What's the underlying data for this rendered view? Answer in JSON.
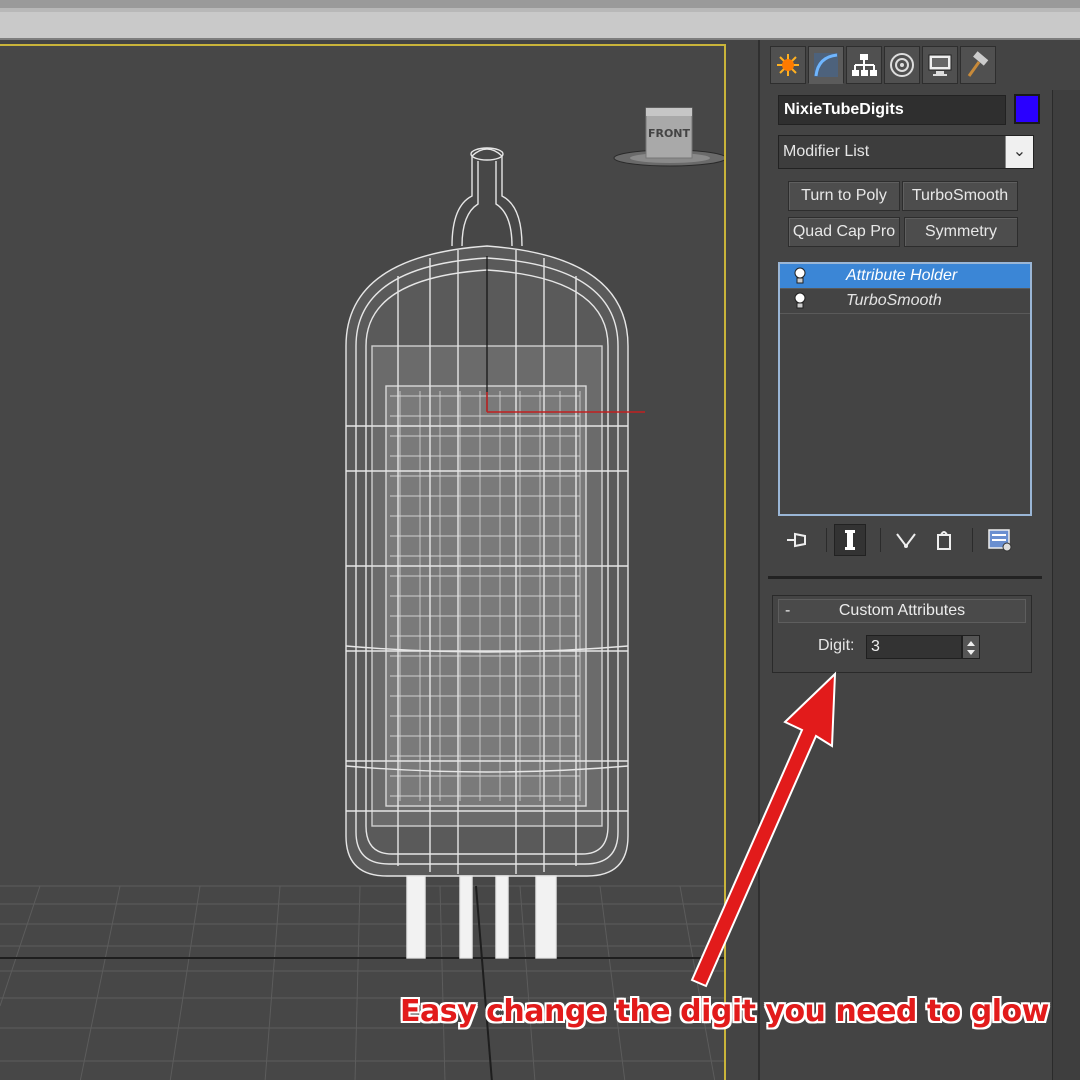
{
  "command_panel": {
    "tabs": [
      {
        "name": "create",
        "icon": "sun-burst-icon"
      },
      {
        "name": "modify",
        "icon": "curve-icon"
      },
      {
        "name": "hierarchy",
        "icon": "hierarchy-icon"
      },
      {
        "name": "motion",
        "icon": "motion-icon"
      },
      {
        "name": "display",
        "icon": "display-icon"
      },
      {
        "name": "utilities",
        "icon": "hammer-icon"
      }
    ],
    "object_name": "NixieTubeDigits",
    "object_color": "#2a00ff",
    "modifier_list": "Modifier List",
    "modifier_buttons": [
      "Turn to Poly",
      "TurboSmooth",
      "Quad Cap Pro",
      "Symmetry"
    ],
    "stack": [
      {
        "label": "Attribute Holder",
        "selected": true
      },
      {
        "label": "TurboSmooth",
        "selected": false
      }
    ],
    "rollout": {
      "toggle": "-",
      "title": "Custom Attributes",
      "digit_label": "Digit:",
      "digit_value": "3"
    }
  },
  "viewport": {
    "viewcube_label": "FRONT"
  },
  "annotation": {
    "text": "Easy change the digit you need to glow",
    "color": "#e21b1b"
  }
}
